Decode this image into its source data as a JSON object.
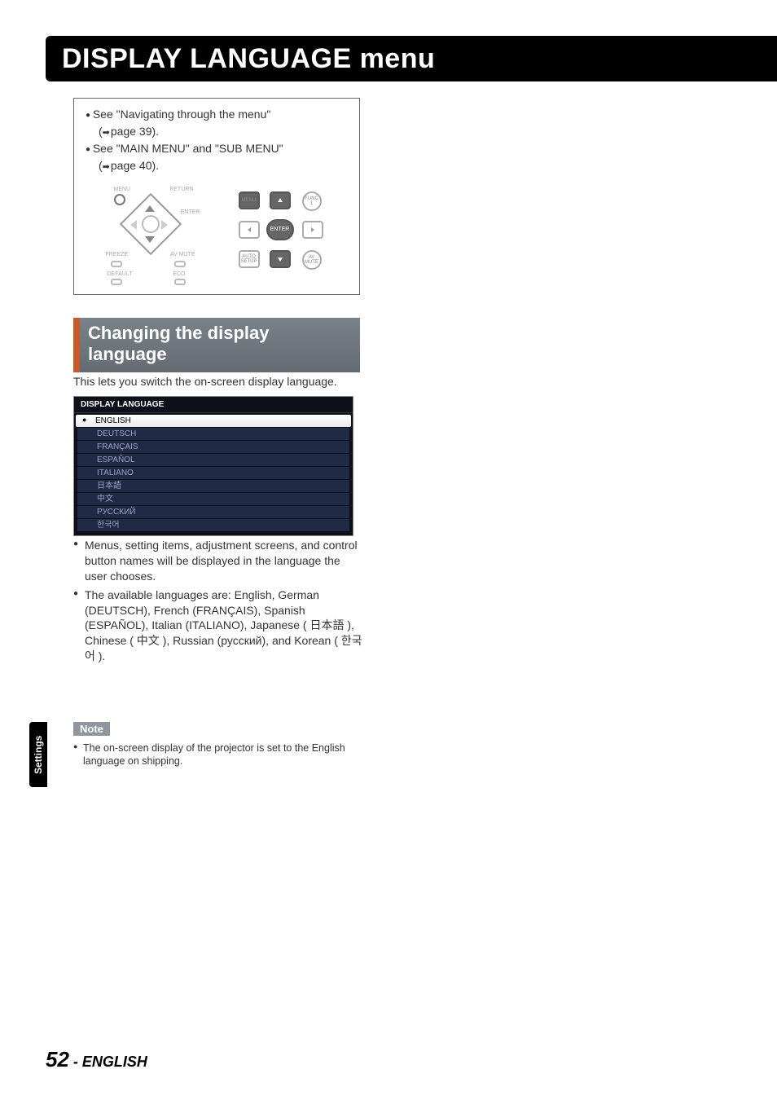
{
  "title": "DISPLAY LANGUAGE menu",
  "info": {
    "line1": "See \"Navigating through the menu\"",
    "line1b": "page 39).",
    "line2": "See \"MAIN MENU\" and \"SUB MENU\"",
    "line2b": "page 40)."
  },
  "ctrl_labels": {
    "menu": "MENU",
    "return": "RETURN",
    "enter": "ENTER",
    "freeze": "FREEZE",
    "avmute": "AV MUTE",
    "default": "DEFAULT",
    "eco": "ECO"
  },
  "remote_labels": {
    "menu": "MENU",
    "func": "FUNC 1",
    "enter": "ENTER",
    "auto": "AUTO SETUP",
    "avmute": "AV MUTE"
  },
  "section_header": "Changing the display language",
  "intro": "This lets you switch the on-screen display language.",
  "lang_header": "DISPLAY LANGUAGE",
  "languages": [
    {
      "label": "ENGLISH",
      "selected": true
    },
    {
      "label": "DEUTSCH",
      "selected": false
    },
    {
      "label": "FRANÇAIS",
      "selected": false
    },
    {
      "label": "ESPAÑOL",
      "selected": false
    },
    {
      "label": "ITALIANO",
      "selected": false
    },
    {
      "label": "日本語",
      "selected": false
    },
    {
      "label": "中文",
      "selected": false
    },
    {
      "label": "РУССКИЙ",
      "selected": false
    },
    {
      "label": "한국어",
      "selected": false
    }
  ],
  "bullets": [
    "Menus, setting items, adjustment screens, and control button names will be displayed in the language the user chooses.",
    "The available languages are: English, German (DEUTSCH), French (FRANÇAIS), Spanish (ESPAÑOL), Italian (ITALIANO), Japanese ( 日本語 ), Chinese ( 中文 ), Russian (русский), and Korean ( 한국어 )."
  ],
  "note_label": "Note",
  "note": "The on-screen display of the projector is set to the English language on shipping.",
  "side_tab": "Settings",
  "footer": {
    "page": "52",
    "dash": " - ",
    "lang": "ENGLISH"
  }
}
